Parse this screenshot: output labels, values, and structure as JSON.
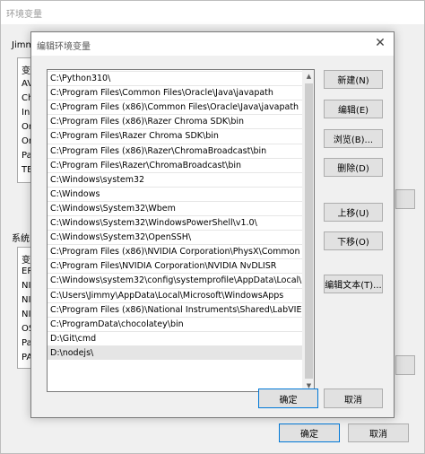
{
  "background_window": {
    "title": "环境变量",
    "user_group_label": "Jimm",
    "system_group_label": "系统",
    "user_list_col_header": "变",
    "user_list_items": [
      "AV",
      "Ch",
      "In",
      "On",
      "On",
      "Pa",
      "TE"
    ],
    "system_list_col_header": "变",
    "system_list_items": [
      "ER",
      "NI",
      "NI",
      "NI",
      "OS",
      "Pa",
      "PA"
    ],
    "ok_label": "确定",
    "cancel_label": "取消"
  },
  "dialog": {
    "title": "编辑环境变量",
    "close_glyph": "✕",
    "paths": [
      "C:\\Python310\\",
      "C:\\Program Files\\Common Files\\Oracle\\Java\\javapath",
      "C:\\Program Files (x86)\\Common Files\\Oracle\\Java\\javapath",
      "C:\\Program Files (x86)\\Razer Chroma SDK\\bin",
      "C:\\Program Files\\Razer Chroma SDK\\bin",
      "C:\\Program Files (x86)\\Razer\\ChromaBroadcast\\bin",
      "C:\\Program Files\\Razer\\ChromaBroadcast\\bin",
      "C:\\Windows\\system32",
      "C:\\Windows",
      "C:\\Windows\\System32\\Wbem",
      "C:\\Windows\\System32\\WindowsPowerShell\\v1.0\\",
      "C:\\Windows\\System32\\OpenSSH\\",
      "C:\\Program Files (x86)\\NVIDIA Corporation\\PhysX\\Common",
      "C:\\Program Files\\NVIDIA Corporation\\NVIDIA NvDLISR",
      "C:\\Windows\\system32\\config\\systemprofile\\AppData\\Local\\...",
      "C:\\Users\\Jimmy\\AppData\\Local\\Microsoft\\WindowsApps",
      "C:\\Program Files (x86)\\National Instruments\\Shared\\LabVIE...",
      "C:\\ProgramData\\chocolatey\\bin",
      "D:\\Git\\cmd",
      "D:\\nodejs\\"
    ],
    "selected_index": 19,
    "buttons": {
      "new": "新建(N)",
      "edit": "编辑(E)",
      "browse": "浏览(B)...",
      "delete": "删除(D)",
      "move_up": "上移(U)",
      "move_down": "下移(O)",
      "edit_text": "编辑文本(T)...",
      "ok": "确定",
      "cancel": "取消"
    },
    "scroll_up_glyph": "▲",
    "scroll_down_glyph": "▼"
  },
  "colors": {
    "accent": "#0078d7",
    "selection": "#e5e5e5"
  }
}
